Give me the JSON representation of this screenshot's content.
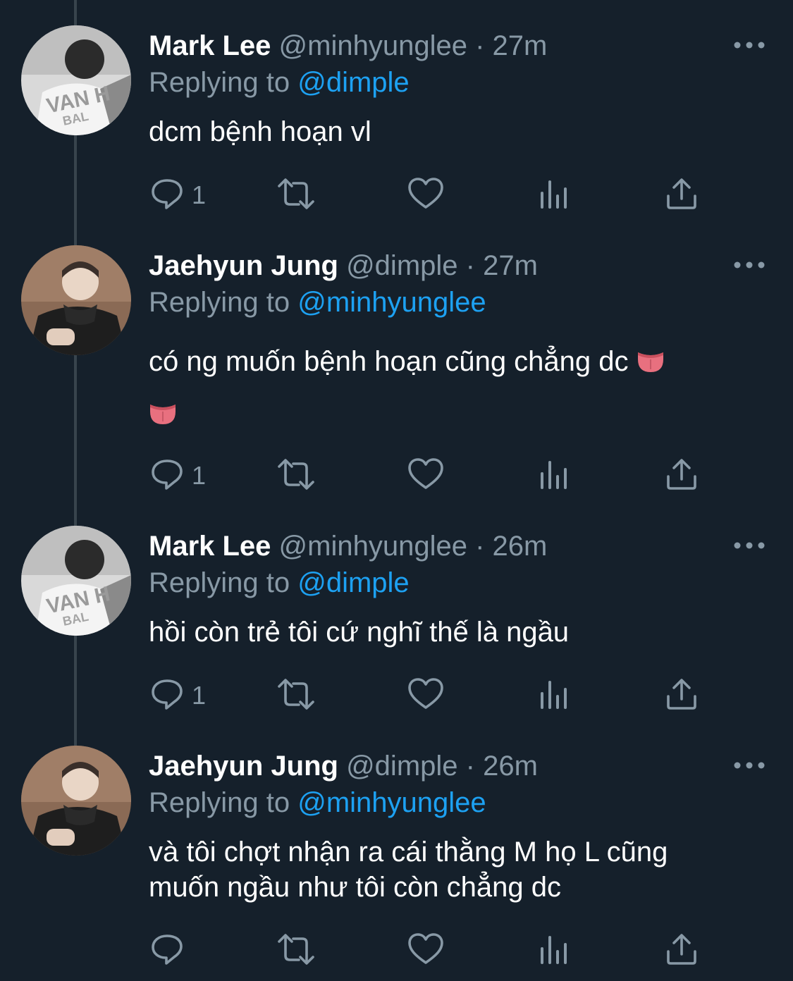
{
  "tweets": [
    {
      "name": "Mark Lee",
      "handle": "@minhyunglee",
      "separator": "·",
      "time": "27m",
      "replying_label": "Replying to ",
      "replying_to": "@dimple",
      "text": "dcm bệnh hoạn vl",
      "reply_count": "1",
      "avatar_icon": "avatar-mark-lee"
    },
    {
      "name": "Jaehyun Jung",
      "handle": "@dimple",
      "separator": "·",
      "time": "27m",
      "replying_label": "Replying to ",
      "replying_to": "@minhyunglee",
      "text": "có ng muốn bệnh hoạn cũng chẳng dc",
      "emoji": "tongue-emoji",
      "reply_count": "1",
      "avatar_icon": "avatar-jaehyun-jung"
    },
    {
      "name": "Mark Lee",
      "handle": "@minhyunglee",
      "separator": "·",
      "time": "26m",
      "replying_label": "Replying to ",
      "replying_to": "@dimple",
      "text": "hồi còn trẻ tôi cứ nghĩ thế là ngầu",
      "reply_count": "1",
      "avatar_icon": "avatar-mark-lee"
    },
    {
      "name": "Jaehyun Jung",
      "handle": "@dimple",
      "separator": "·",
      "time": "26m",
      "replying_label": "Replying to ",
      "replying_to": "@minhyunglee",
      "text_line1": "và tôi chợt nhận ra cái thằng M họ L cũng",
      "text_line2": "muốn ngầu như tôi còn chẳng dc",
      "reply_count": "",
      "avatar_icon": "avatar-jaehyun-jung"
    }
  ],
  "colors": {
    "background": "#15202b",
    "text": "#ffffff",
    "secondary": "#8899a6",
    "link": "#1da1f2",
    "thread_line": "#38444d"
  },
  "icons": [
    "reply-icon",
    "retweet-icon",
    "like-icon",
    "analytics-icon",
    "share-icon",
    "more-icon"
  ]
}
